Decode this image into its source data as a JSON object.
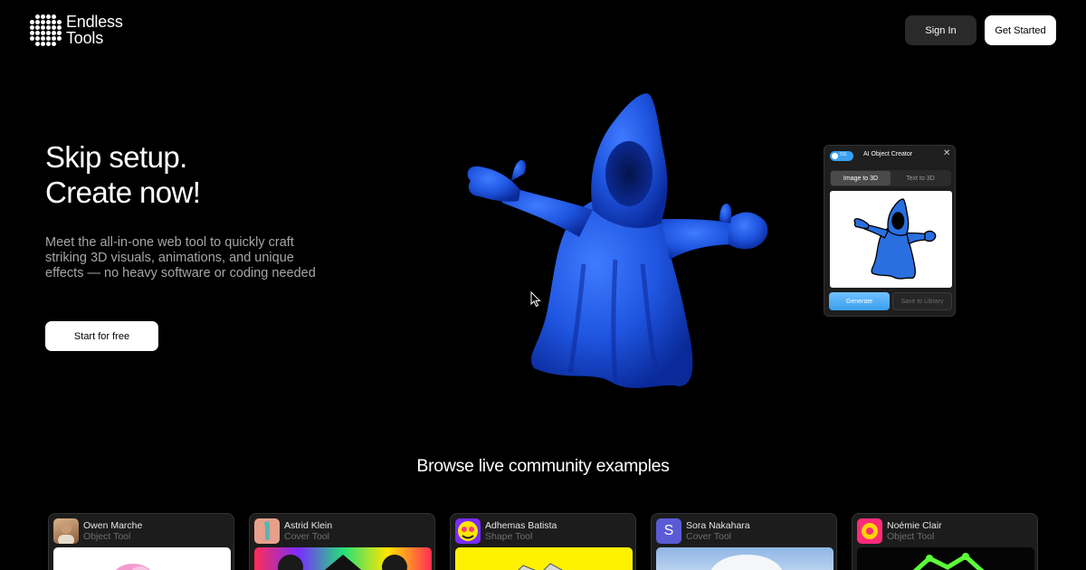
{
  "header": {
    "logo_line1": "Endless",
    "logo_line2": "Tools",
    "signin_label": "Sign In",
    "get_started_label": "Get Started"
  },
  "hero": {
    "title_line1": "Skip setup.",
    "title_line2": "Create now!",
    "description": "Meet the all-in-one web tool to quickly craft striking 3D visuals, animations, and unique effects — no heavy software or coding needed",
    "cta_label": "Start for free"
  },
  "panel": {
    "toggle_text": "50L",
    "title": "AI Object Creator",
    "close_glyph": "✕",
    "tabs": [
      "Image to 3D",
      "Text to 3D"
    ],
    "generate_label": "Generate",
    "save_label": "Save to Library",
    "accent_color": "#3aa0f0"
  },
  "browse": {
    "title": "Browse live community examples",
    "cards": [
      {
        "name": "Owen Marche",
        "tool": "Object Tool"
      },
      {
        "name": "Astrid Klein",
        "tool": "Cover Tool"
      },
      {
        "name": "Adhemas Batista",
        "tool": "Shape Tool"
      },
      {
        "name": "Sora Nakahara",
        "tool": "Cover Tool",
        "avatar_letter": "S"
      },
      {
        "name": "Noémie Clair",
        "tool": "Object Tool"
      }
    ]
  },
  "colors": {
    "background": "#000000",
    "figure_blue": "#1f55e0"
  }
}
